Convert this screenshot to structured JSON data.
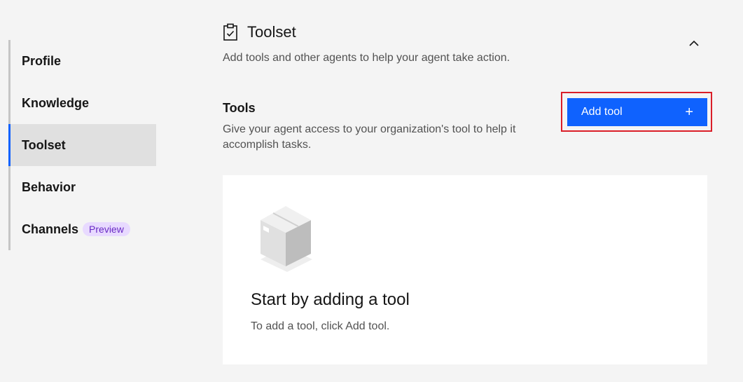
{
  "sidebar": {
    "items": [
      {
        "label": "Profile"
      },
      {
        "label": "Knowledge"
      },
      {
        "label": "Toolset",
        "active": true
      },
      {
        "label": "Behavior"
      },
      {
        "label": "Channels",
        "badge": "Preview"
      }
    ]
  },
  "section": {
    "title": "Toolset",
    "icon": "clipboard-check-icon",
    "description": "Add tools and other agents to help your agent take action.",
    "collapse_icon": "chevron-up-icon"
  },
  "tools": {
    "heading": "Tools",
    "description": "Give your agent access to your organization's tool to help it accomplish tasks.",
    "add_button_label": "Add tool",
    "add_button_icon": "+"
  },
  "empty_state": {
    "illustration": "box-icon",
    "title": "Start by adding a tool",
    "description": "To add a tool, click Add tool."
  },
  "colors": {
    "primary": "#0f62fe",
    "highlight": "#da1e28",
    "badge_bg": "#e8daff",
    "badge_text": "#6929c4"
  }
}
